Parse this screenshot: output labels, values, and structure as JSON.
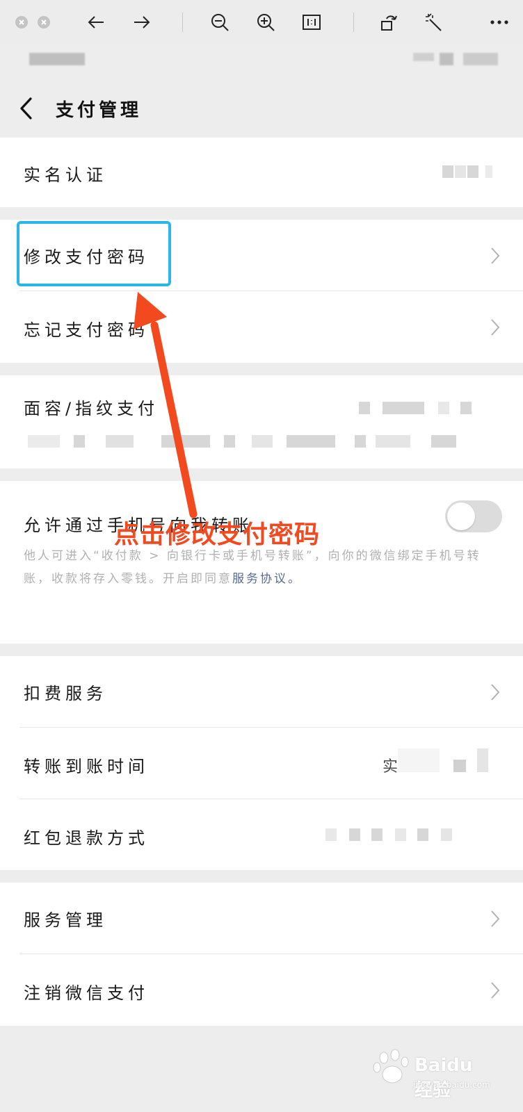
{
  "header": {
    "title": "支付管理"
  },
  "rows": {
    "real_name": "实名认证",
    "change_pwd": "修改支付密码",
    "forgot_pwd": "忘记支付密码",
    "face_fp": "面容/指纹支付",
    "allow_phone": "允许通过手机号向我转账",
    "deduction": "扣费服务",
    "transfer_time": "转账到账时间",
    "red_packet_refund": "红包退款方式",
    "service_mgmt": "服务管理",
    "cancel_pay": "注销微信支付"
  },
  "allow_phone_desc": {
    "text": "他人可进入“收付款 > 向银行卡或手机号转账”，向你的微信绑定手机号转账，收款将存入零钱。开启即同意",
    "link": "服务协议。"
  },
  "toggles": {
    "allow_phone_on": false
  },
  "annotation": {
    "text": "点击修改支付密码",
    "color": "#f2491e",
    "box_color": "#27b8e6"
  },
  "transfer_time_value_partial": "实",
  "watermark": {
    "logo": "Baidu经验",
    "url": "jingyan.baidu.com"
  },
  "icons": [
    "close-icon",
    "minimize-icon",
    "back-arrow-icon",
    "forward-arrow-icon",
    "zoom-out-icon",
    "zoom-in-icon",
    "actual-size-icon",
    "rotate-icon",
    "magic-wand-icon",
    "more-icon",
    "back-chevron-icon",
    "chevron-right-icon"
  ]
}
